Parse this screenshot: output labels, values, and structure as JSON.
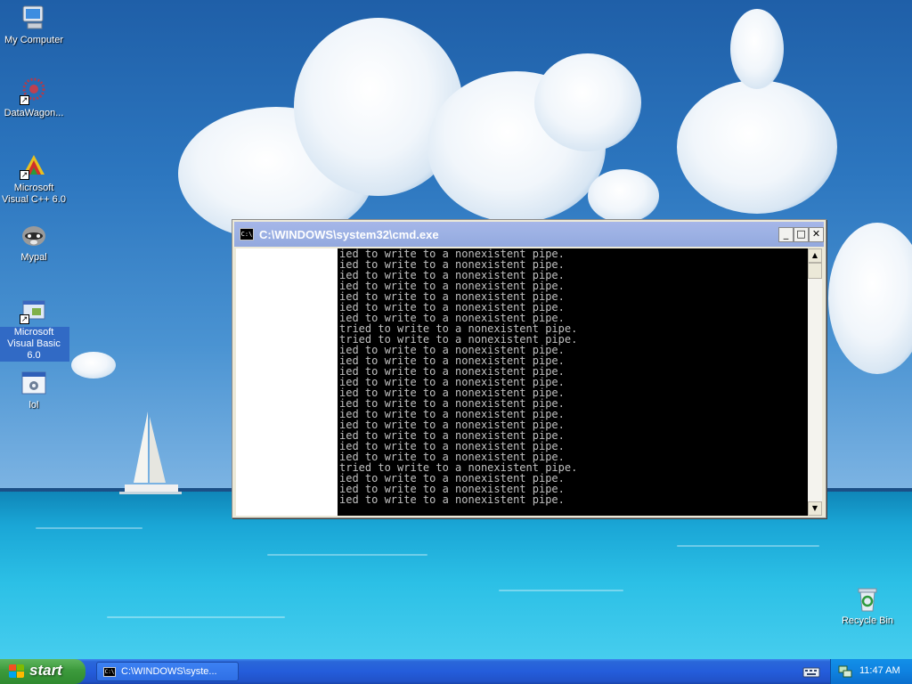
{
  "desktop": {
    "icons": [
      {
        "label": "My Computer"
      },
      {
        "label": "DataWagon..."
      },
      {
        "label": "Microsoft Visual C++ 6.0"
      },
      {
        "label": "Mypal"
      },
      {
        "label": "Microsoft Visual Basic 6.0"
      },
      {
        "label": "lol"
      },
      {
        "label": "Recycle Bin"
      }
    ]
  },
  "window": {
    "title": "C:\\WINDOWS\\system32\\cmd.exe",
    "icon_text": "C:\\",
    "console_lines": [
      "ied to write to a nonexistent pipe.",
      "ied to write to a nonexistent pipe.",
      "ied to write to a nonexistent pipe.",
      "ied to write to a nonexistent pipe.",
      "ied to write to a nonexistent pipe.",
      "ied to write to a nonexistent pipe.",
      "ied to write to a nonexistent pipe.",
      "tried to write to a nonexistent pipe.",
      "tried to write to a nonexistent pipe.",
      "ied to write to a nonexistent pipe.",
      "ied to write to a nonexistent pipe.",
      "ied to write to a nonexistent pipe.",
      "ied to write to a nonexistent pipe.",
      "ied to write to a nonexistent pipe.",
      "ied to write to a nonexistent pipe.",
      "ied to write to a nonexistent pipe.",
      "ied to write to a nonexistent pipe.",
      "ied to write to a nonexistent pipe.",
      "ied to write to a nonexistent pipe.",
      "ied to write to a nonexistent pipe.",
      "tried to write to a nonexistent pipe.",
      "ied to write to a nonexistent pipe.",
      "ied to write to a nonexistent pipe.",
      "ied to write to a nonexistent pipe."
    ],
    "buttons": {
      "minimize": "_",
      "maximize": "□",
      "close": "✕"
    },
    "scroll": {
      "up": "▲",
      "down": "▼"
    }
  },
  "taskbar": {
    "start_label": "start",
    "task_label": "C:\\WINDOWS\\syste...",
    "clock": "11:47 AM"
  },
  "icons": {
    "start_flag": "windows-flag-icon",
    "tray": "network-icon",
    "language": "keyboard-icon"
  },
  "colors": {
    "console_bg": "#000000",
    "console_text": "#c0c0c0",
    "titlebar_inactive": "#9cb1e4",
    "taskbar": "#245ddb",
    "start_green": "#3c9a3c",
    "selection": "#316ac5"
  }
}
